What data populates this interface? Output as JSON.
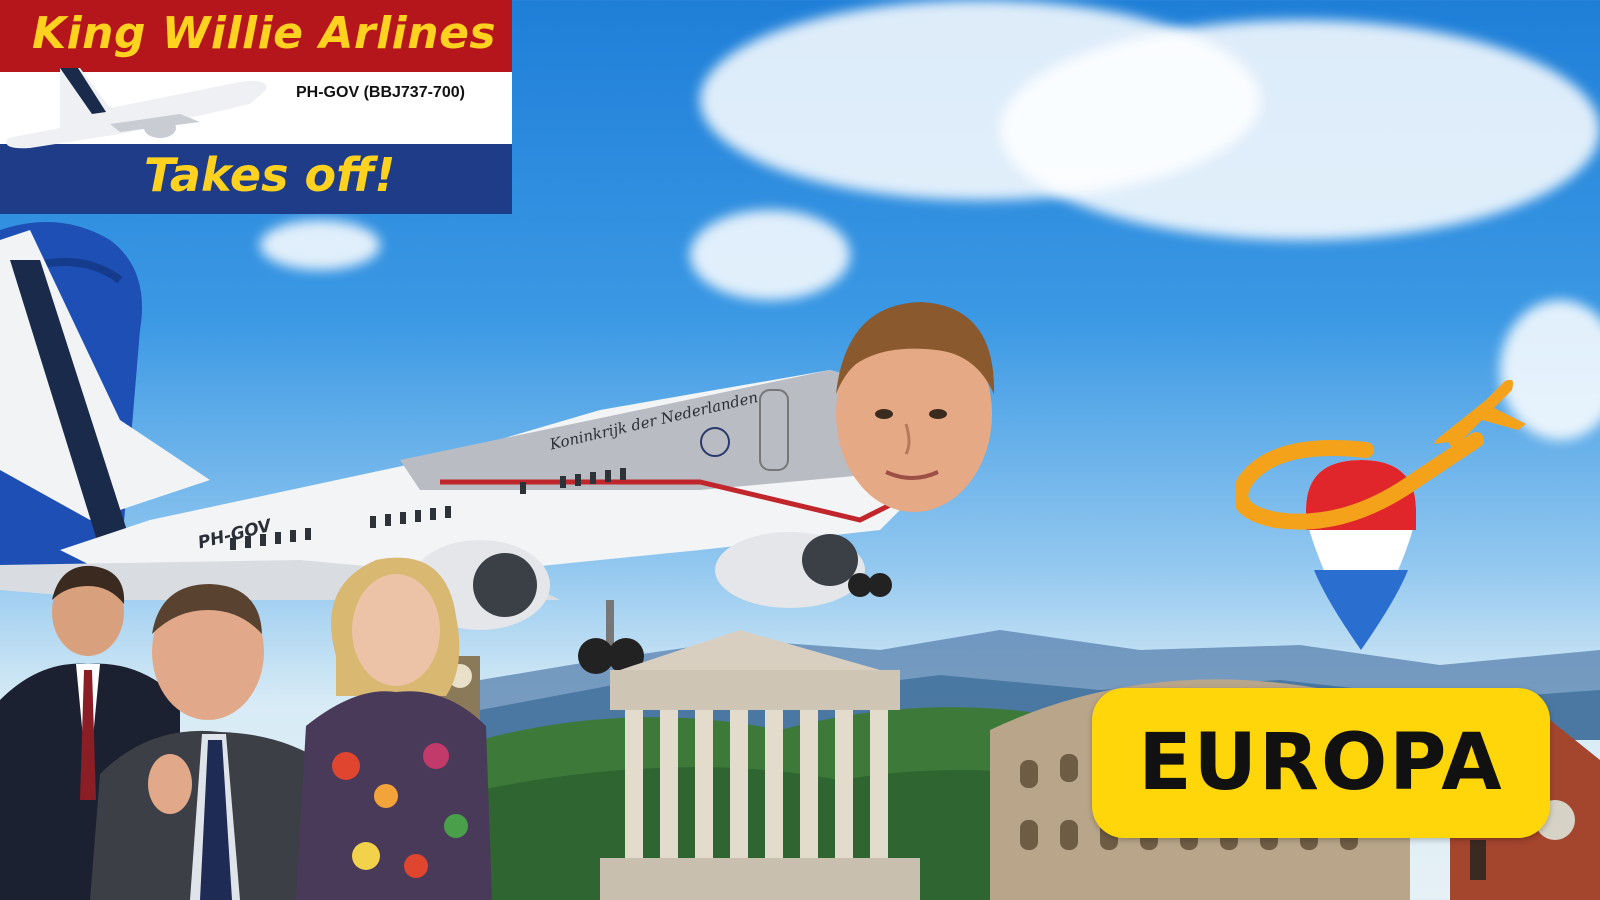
{
  "banner": {
    "title": "King Willie Arlines",
    "registration": "PH-GOV (BBJ737-700)",
    "subtitle": "Takes off!"
  },
  "aircraft": {
    "fuselage_text": "Koninkrijk der Nederlanden",
    "registration_mark": "PH-GOV"
  },
  "badge": {
    "label": "EUROPA"
  },
  "colors": {
    "banner_red": "#b5161b",
    "banner_white": "#ffffff",
    "banner_blue": "#1f3c88",
    "banner_text": "#ffd21f",
    "badge_bg": "#ffd60a",
    "logo_orange": "#f5a21b"
  },
  "icons": [
    "airplane-icon",
    "location-pin-icon",
    "eu-flag-icon"
  ]
}
